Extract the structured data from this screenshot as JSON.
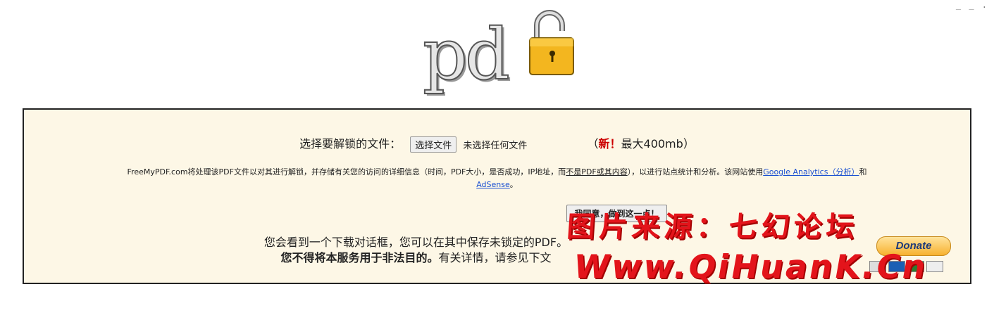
{
  "corner": {
    "text": "_ _ ."
  },
  "logo": {
    "text": "pd"
  },
  "upload": {
    "label": "选择要解锁的文件：",
    "choose_button": "选择文件",
    "file_status": "未选择任何文件",
    "limit_open": "（",
    "new_tag": "新！",
    "limit_text": "最大400mb",
    "limit_close": "）"
  },
  "privacy": {
    "part1": "FreeMyPDF.com将处理该PDF文件以对其进行解锁，并存储有关您的访问的详细信息（时间，PDF大小，是否成功，IP地址，而",
    "underlined": "不是PDF或其内容",
    "part2": "），以进行站点统计和分析。该网站使用",
    "ga_link": "Google Analytics（分析）",
    "and": "和",
    "adsense_link": "AdSense",
    "end": "。"
  },
  "agree_button": "我同意，做到这一点！",
  "download_note": {
    "line1": "您会看到一个下载对话框，您可以在其中保存未锁定的PDF。",
    "bold": "您不得将本服务用于非法目的。",
    "line2_rest": "有关详情，请参见下文"
  },
  "donate": {
    "label": "Donate"
  },
  "watermark": {
    "line1": "图片来源：七幻论坛",
    "line2": "Www.QiHuanK.Cn"
  },
  "colors": {
    "panel_bg": "#fdf7e6",
    "accent_red": "#cc0000",
    "link_blue": "#1a4fd1"
  }
}
